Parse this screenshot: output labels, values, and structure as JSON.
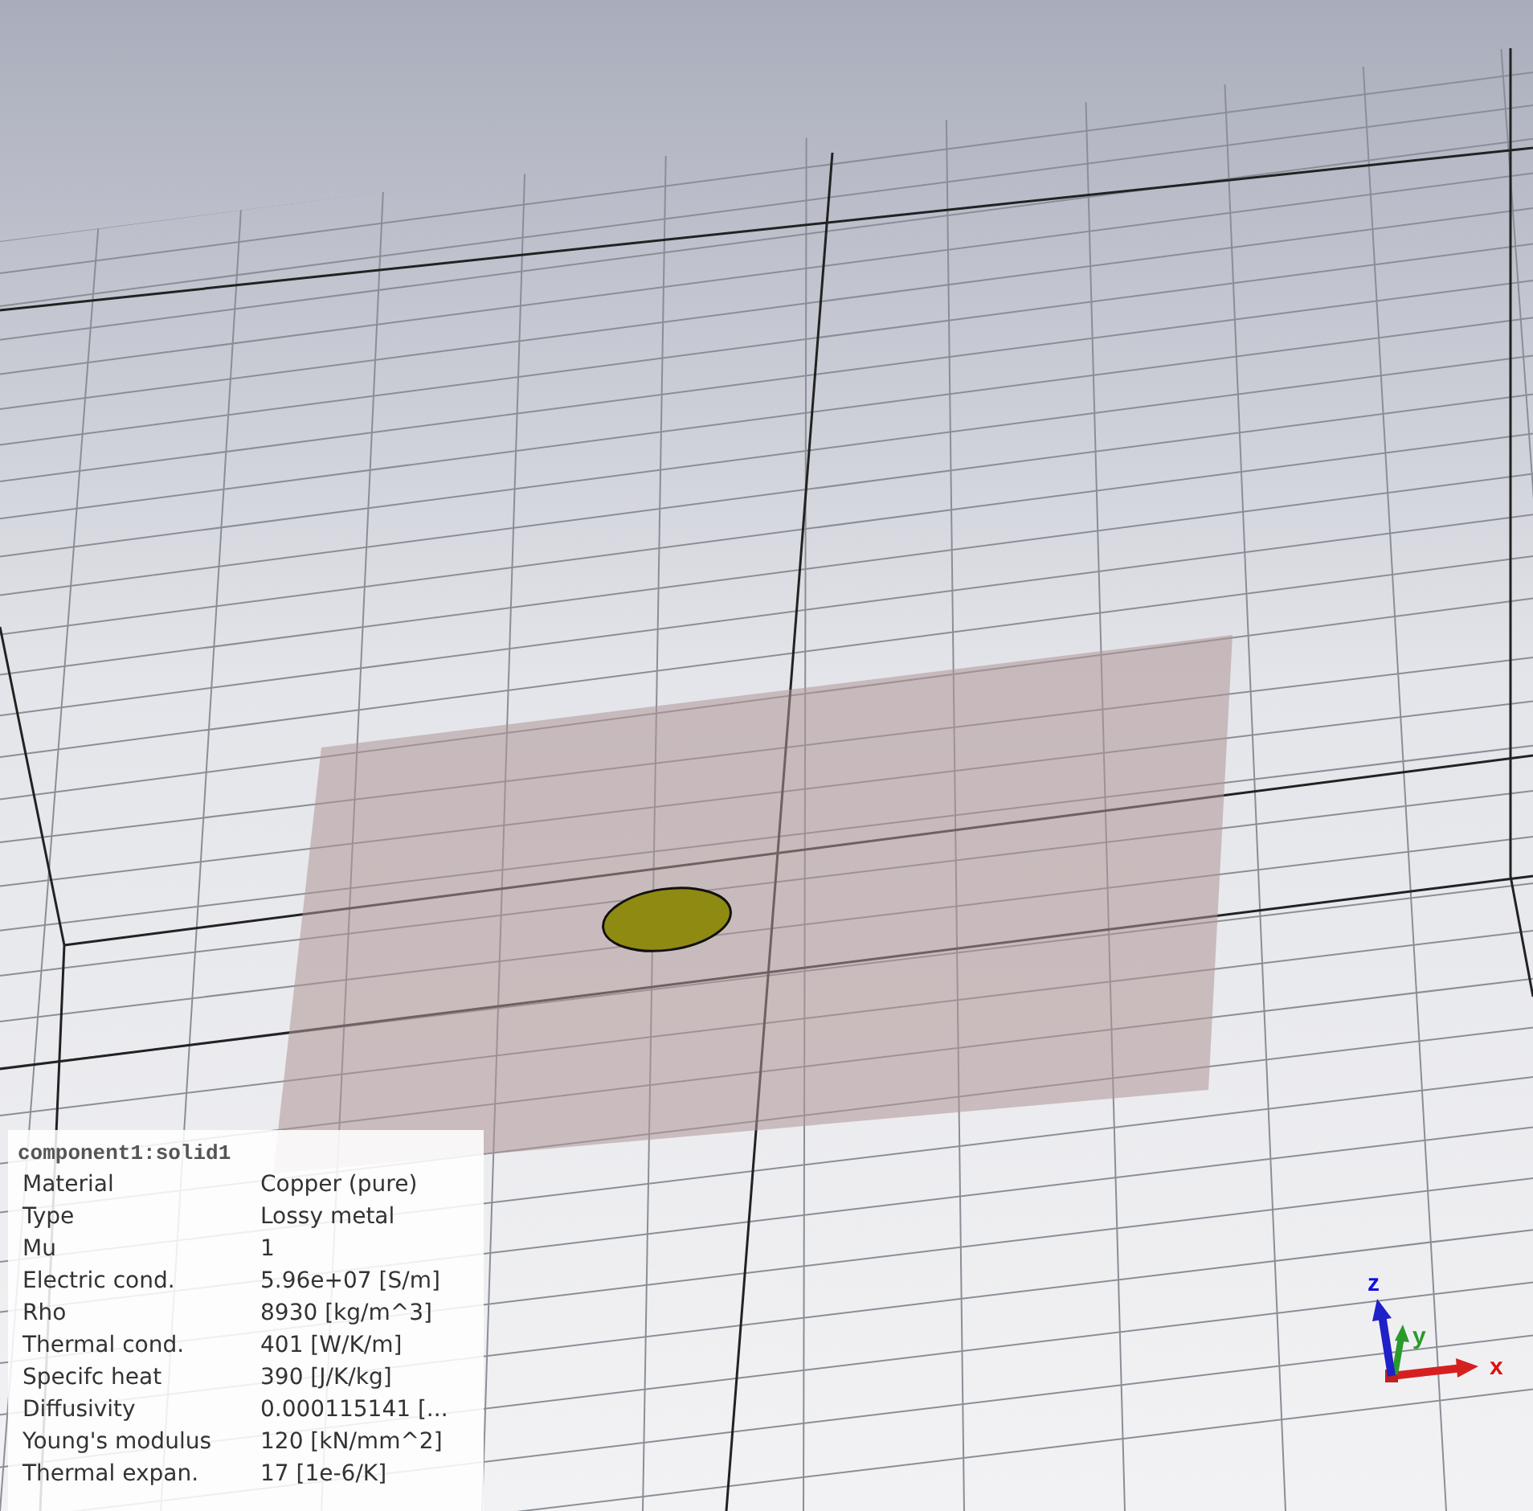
{
  "info_panel": {
    "title": "component1:solid1",
    "properties": [
      {
        "label": "Material",
        "value": "Copper (pure)"
      },
      {
        "label": "Type",
        "value": "Lossy metal"
      },
      {
        "label": "Mu",
        "value": "1"
      },
      {
        "label": "Electric cond.",
        "value": "5.96e+07 [S/m]"
      },
      {
        "label": "Rho",
        "value": "8930 [kg/m^3]"
      },
      {
        "label": "Thermal cond.",
        "value": "401 [W/K/m]"
      },
      {
        "label": "Specifc heat",
        "value": "390 [J/K/kg]"
      },
      {
        "label": "Diffusivity",
        "value": "0.000115141 [..."
      },
      {
        "label": "Young's modulus",
        "value": "120 [kN/mm^2]"
      },
      {
        "label": "Thermal expan.",
        "value": "17 [1e-6/K]"
      }
    ]
  },
  "axes": {
    "x_label": "x",
    "y_label": "y",
    "z_label": "z"
  }
}
